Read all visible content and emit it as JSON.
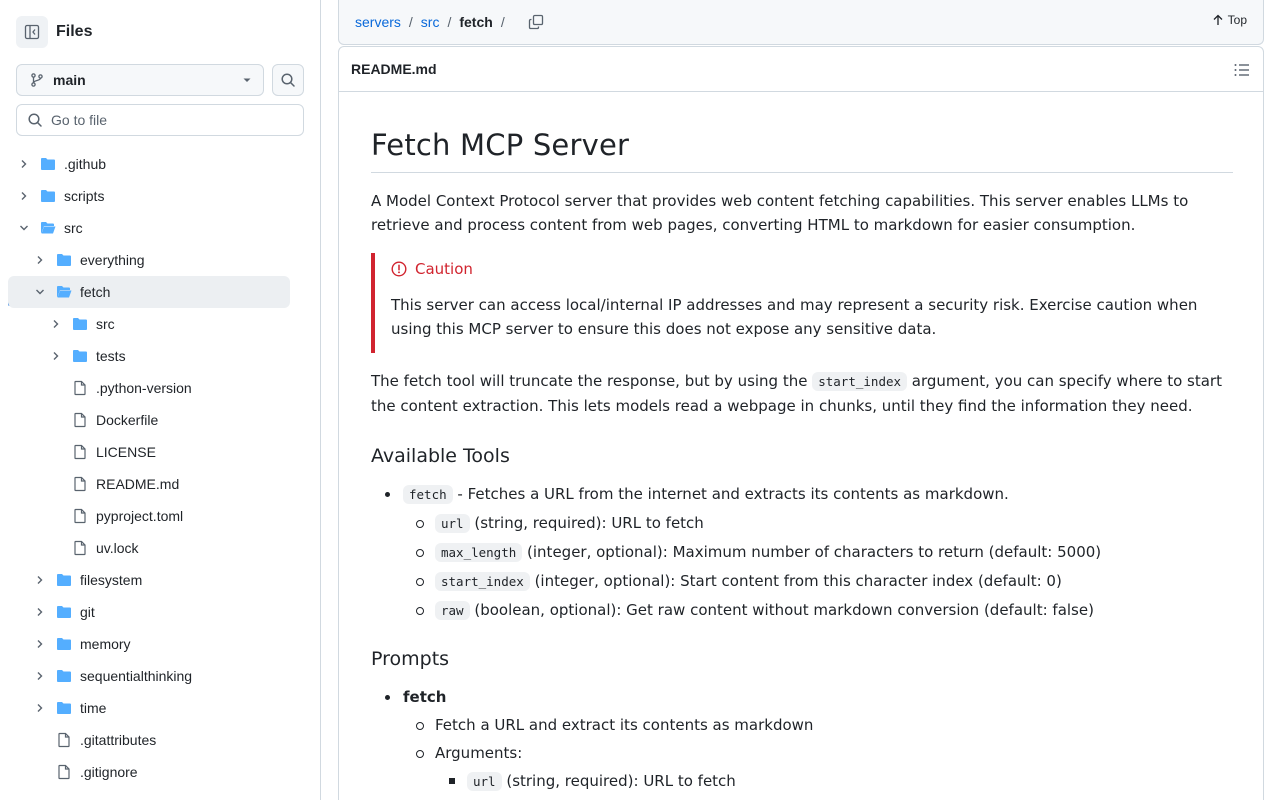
{
  "sidebar": {
    "title": "Files",
    "branch": "main",
    "search_placeholder": "Go to file",
    "tree": [
      {
        "name": ".github",
        "type": "folder",
        "expanded": false,
        "depth": 0
      },
      {
        "name": "scripts",
        "type": "folder",
        "expanded": false,
        "depth": 0
      },
      {
        "name": "src",
        "type": "folder",
        "expanded": true,
        "depth": 0
      },
      {
        "name": "everything",
        "type": "folder",
        "expanded": false,
        "depth": 1
      },
      {
        "name": "fetch",
        "type": "folder",
        "expanded": true,
        "depth": 1,
        "selected": true
      },
      {
        "name": "src",
        "type": "folder",
        "expanded": false,
        "depth": 2
      },
      {
        "name": "tests",
        "type": "folder",
        "expanded": false,
        "depth": 2
      },
      {
        "name": ".python-version",
        "type": "file",
        "depth": 2
      },
      {
        "name": "Dockerfile",
        "type": "file",
        "depth": 2
      },
      {
        "name": "LICENSE",
        "type": "file",
        "depth": 2
      },
      {
        "name": "README.md",
        "type": "file",
        "depth": 2
      },
      {
        "name": "pyproject.toml",
        "type": "file",
        "depth": 2
      },
      {
        "name": "uv.lock",
        "type": "file",
        "depth": 2
      },
      {
        "name": "filesystem",
        "type": "folder",
        "expanded": false,
        "depth": 1
      },
      {
        "name": "git",
        "type": "folder",
        "expanded": false,
        "depth": 1
      },
      {
        "name": "memory",
        "type": "folder",
        "expanded": false,
        "depth": 1
      },
      {
        "name": "sequentialthinking",
        "type": "folder",
        "expanded": false,
        "depth": 1
      },
      {
        "name": "time",
        "type": "folder",
        "expanded": false,
        "depth": 1
      },
      {
        "name": ".gitattributes",
        "type": "file",
        "depth": 1
      },
      {
        "name": ".gitignore",
        "type": "file",
        "depth": 1
      }
    ]
  },
  "breadcrumb": {
    "repo": "servers",
    "sep": "/",
    "dir": "src",
    "current": "fetch",
    "top_label": "Top"
  },
  "file": {
    "name": "README.md"
  },
  "readme": {
    "title": "Fetch MCP Server",
    "intro": "A Model Context Protocol server that provides web content fetching capabilities. This server enables LLMs to retrieve and process content from web pages, converting HTML to markdown for easier consumption.",
    "caution_title": "Caution",
    "caution_text": "This server can access local/internal IP addresses and may represent a security risk. Exercise caution when using this MCP server to ensure this does not expose any sensitive data.",
    "trunc_pre": "The fetch tool will truncate the response, but by using the ",
    "trunc_code": "start_index",
    "trunc_post": " argument, you can specify where to start the content extraction. This lets models read a webpage in chunks, until they find the information they need.",
    "tools_heading": "Available Tools",
    "tool_code": "fetch",
    "tool_desc": " - Fetches a URL from the internet and extracts its contents as markdown.",
    "params": [
      {
        "code": "url",
        "desc": " (string, required): URL to fetch"
      },
      {
        "code": "max_length",
        "desc": " (integer, optional): Maximum number of characters to return (default: 5000)"
      },
      {
        "code": "start_index",
        "desc": " (integer, optional): Start content from this character index (default: 0)"
      },
      {
        "code": "raw",
        "desc": " (boolean, optional): Get raw content without markdown conversion (default: false)"
      }
    ],
    "prompts_heading": "Prompts",
    "prompt_name": "fetch",
    "prompt_desc": "Fetch a URL and extract its contents as markdown",
    "arguments_label": "Arguments:",
    "arg_code": "url",
    "arg_desc": " (string, required): URL to fetch"
  },
  "colors": {
    "accent": "#0969da",
    "caution": "#d1242f",
    "folder": "#54aeff",
    "border": "#d1d9e0"
  }
}
